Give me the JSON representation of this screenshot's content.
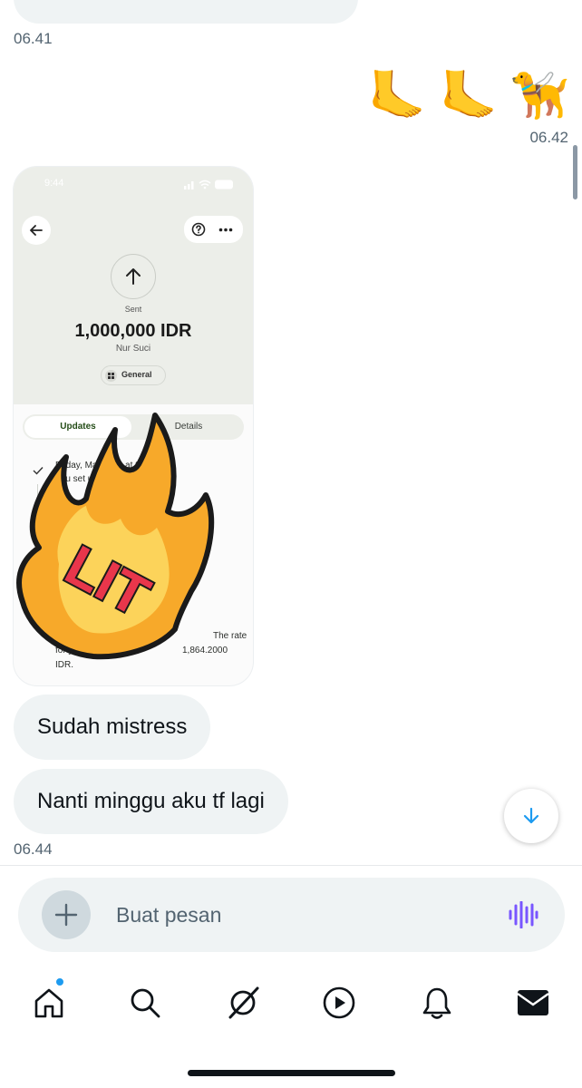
{
  "chat": {
    "time_1": "06.41",
    "emoji_sent": [
      "🦶",
      "🦶",
      "🦮"
    ],
    "time_2": "06.42",
    "time_3": "06.44"
  },
  "transfer_screenshot": {
    "status_time": "9:44",
    "battery": "77",
    "status_label": "Sent",
    "amount": "1,000,000 IDR",
    "recipient": "Nur Suci",
    "category": "General",
    "tabs": [
      "Updates",
      "Details"
    ],
    "update_line_1": "Friday, March 21 at 9:43 AM",
    "update_line_2": "You set up your transfer",
    "rate_line_1": "The rate",
    "rate_line_2": "for your transfer",
    "rate_line_3": "1,864.2000",
    "rate_line_4": "IDR.",
    "sticker_text": "LIT"
  },
  "messages": [
    {
      "text": "Sudah mistress"
    },
    {
      "text": "Nanti minggu aku tf lagi"
    }
  ],
  "composer": {
    "placeholder": "Buat pesan"
  },
  "nav": {
    "items": [
      "home-icon",
      "search-icon",
      "grok-icon",
      "video-icon",
      "notifications-icon",
      "messages-icon"
    ],
    "badge_color": "#1d9bf0"
  },
  "colors": {
    "bubble": "#eff3f4",
    "accent": "#1d9bf0",
    "voice": "#7856ff"
  }
}
